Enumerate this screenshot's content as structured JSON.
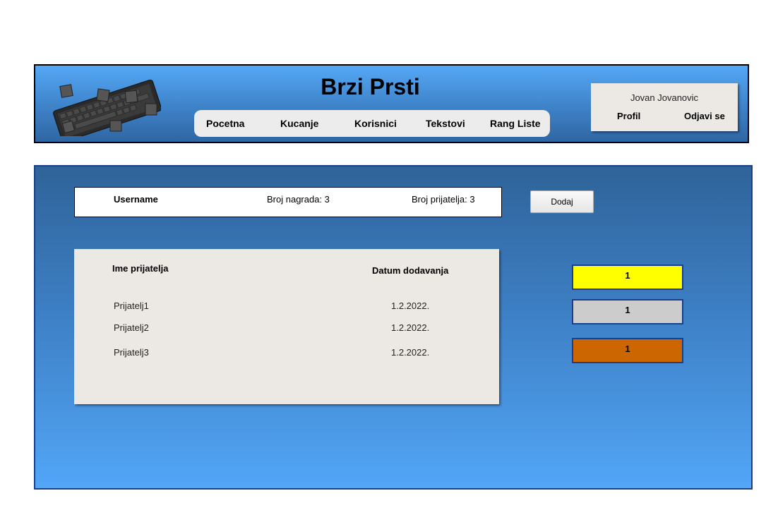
{
  "header": {
    "title": "Brzi Prsti",
    "logo_icon": "keyboard-icon",
    "nav": [
      {
        "label": "Pocetna"
      },
      {
        "label": "Kucanje"
      },
      {
        "label": "Korisnici"
      },
      {
        "label": "Tekstovi"
      },
      {
        "label": "Rang Liste"
      }
    ],
    "user": {
      "name": "Jovan Jovanovic",
      "profile_label": "Profil",
      "logout_label": "Odjavi se"
    }
  },
  "profile": {
    "username": "Username",
    "awards": "Broj nagrada: 3",
    "friends_count": "Broj prijatelja: 3",
    "add_label": "Dodaj"
  },
  "friends": {
    "columns": [
      "Ime prijatelja",
      "Datum dodavanja"
    ],
    "rows": [
      {
        "name": "Prijatelj1",
        "date": "1.2.2022."
      },
      {
        "name": "Prijatelj2",
        "date": "1.2.2022."
      },
      {
        "name": "Prijatelj3",
        "date": "1.2.2022."
      }
    ]
  },
  "medals": [
    {
      "value": "1",
      "color": "#ffff00"
    },
    {
      "value": "1",
      "color": "#cccccc"
    },
    {
      "value": "1",
      "color": "#cc6600"
    }
  ]
}
